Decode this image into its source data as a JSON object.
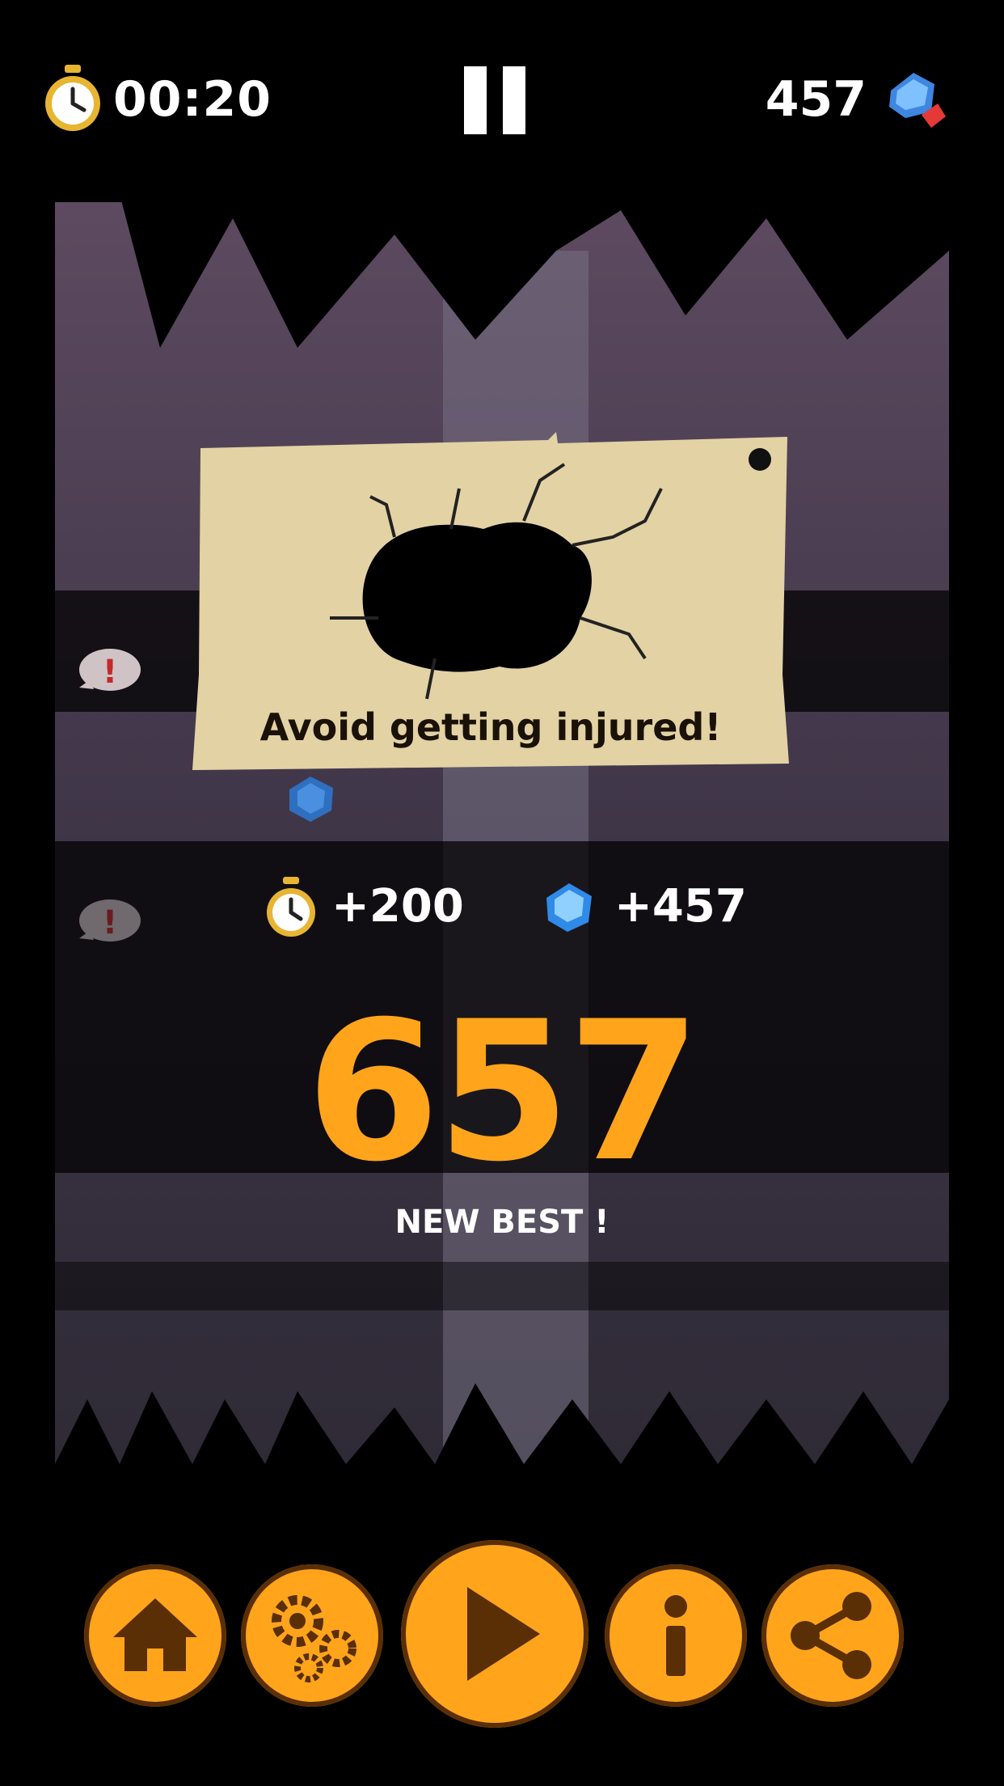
{
  "hud": {
    "time": "00:20",
    "gems": "457",
    "icons": {
      "timer": "stopwatch-icon",
      "gem": "gem-icon",
      "pause": "pause-icon"
    }
  },
  "card": {
    "message": "Avoid getting injured!",
    "illustration": "cracked-hole"
  },
  "bonuses": {
    "time_bonus": "+200",
    "gem_bonus": "+457"
  },
  "result": {
    "score": "657",
    "label": "NEW BEST !"
  },
  "buttons": [
    {
      "name": "home",
      "icon": "home-icon"
    },
    {
      "name": "settings",
      "icon": "gears-icon"
    },
    {
      "name": "play",
      "icon": "play-icon"
    },
    {
      "name": "info",
      "icon": "info-icon"
    },
    {
      "name": "share",
      "icon": "share-icon"
    }
  ],
  "colors": {
    "accent": "#ffa41b",
    "paper": "#e3d2a4",
    "background": "#000000"
  }
}
